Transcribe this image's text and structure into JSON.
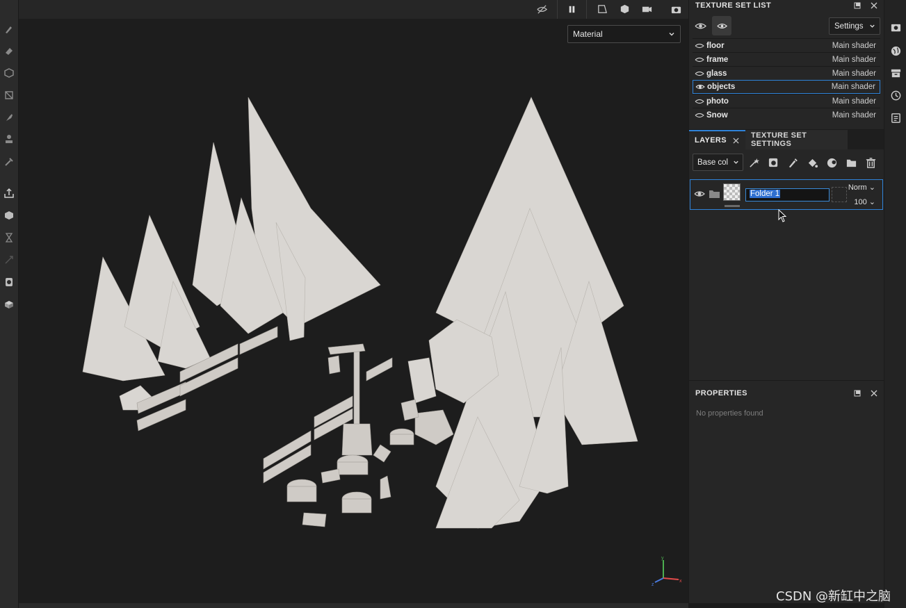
{
  "texture_set_list": {
    "title": "TEXTURE SET LIST",
    "settings_label": "Settings",
    "items": [
      {
        "name": "floor",
        "shader": "Main shader"
      },
      {
        "name": "frame",
        "shader": "Main shader"
      },
      {
        "name": "glass",
        "shader": "Main shader"
      },
      {
        "name": "objects",
        "shader": "Main shader",
        "selected": true
      },
      {
        "name": "photo",
        "shader": "Main shader"
      },
      {
        "name": "Snow",
        "shader": "Main shader"
      }
    ]
  },
  "layers": {
    "tabs": [
      "LAYERS",
      "TEXTURE SET SETTINGS"
    ],
    "channel": "Base col",
    "layer": {
      "name": "Folder 1",
      "blend_mode": "Norm",
      "opacity": "100"
    }
  },
  "viewport": {
    "display_mode": "Material"
  },
  "properties": {
    "title": "PROPERTIES",
    "empty_text": "No properties found"
  },
  "watermark": "CSDN @新缸中之脑",
  "colors": {
    "accent": "#2f83d9",
    "panel": "#262626",
    "viewport": "#1d1d1d"
  }
}
